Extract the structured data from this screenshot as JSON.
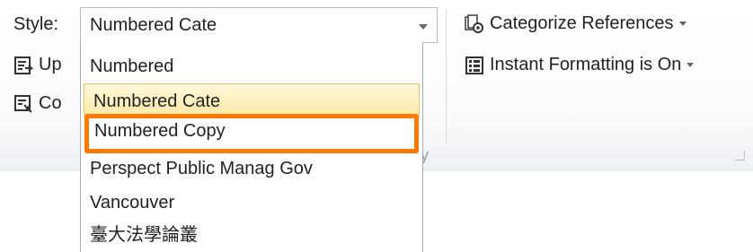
{
  "style_group": {
    "label": "Style:",
    "selected_value": "Numbered Cate",
    "dropdown_items": [
      "Numbered",
      "Numbered Cate",
      "Numbered Copy",
      "Perspect Public Manag Gov",
      "Vancouver",
      "臺大法學論叢"
    ],
    "selected_index": 1,
    "highlighted_index": 2
  },
  "partial_buttons": {
    "update_label": "Up",
    "convert_label": "Co"
  },
  "right_buttons": {
    "categorize_label": "Categorize References",
    "instant_label": "Instant Formatting is On"
  },
  "group_label_fragment": "y",
  "colors": {
    "highlight_outline": "#ff7a00",
    "selected_bg": "#fde9a8",
    "selected_border": "#e5c365"
  }
}
